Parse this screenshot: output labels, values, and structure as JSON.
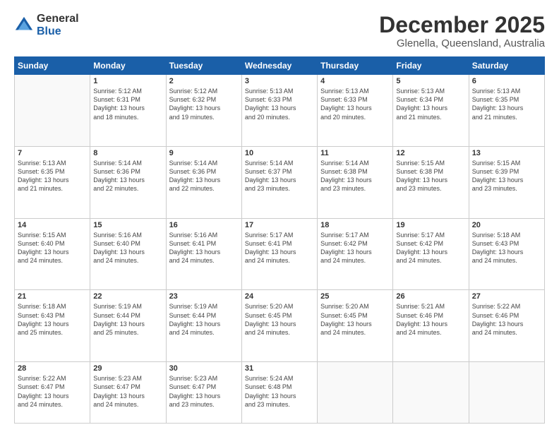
{
  "logo": {
    "general": "General",
    "blue": "Blue"
  },
  "header": {
    "title": "December 2025",
    "subtitle": "Glenella, Queensland, Australia"
  },
  "weekdays": [
    "Sunday",
    "Monday",
    "Tuesday",
    "Wednesday",
    "Thursday",
    "Friday",
    "Saturday"
  ],
  "weeks": [
    [
      {
        "day": "",
        "info": ""
      },
      {
        "day": "1",
        "info": "Sunrise: 5:12 AM\nSunset: 6:31 PM\nDaylight: 13 hours\nand 18 minutes."
      },
      {
        "day": "2",
        "info": "Sunrise: 5:12 AM\nSunset: 6:32 PM\nDaylight: 13 hours\nand 19 minutes."
      },
      {
        "day": "3",
        "info": "Sunrise: 5:13 AM\nSunset: 6:33 PM\nDaylight: 13 hours\nand 20 minutes."
      },
      {
        "day": "4",
        "info": "Sunrise: 5:13 AM\nSunset: 6:33 PM\nDaylight: 13 hours\nand 20 minutes."
      },
      {
        "day": "5",
        "info": "Sunrise: 5:13 AM\nSunset: 6:34 PM\nDaylight: 13 hours\nand 21 minutes."
      },
      {
        "day": "6",
        "info": "Sunrise: 5:13 AM\nSunset: 6:35 PM\nDaylight: 13 hours\nand 21 minutes."
      }
    ],
    [
      {
        "day": "7",
        "info": "Sunrise: 5:13 AM\nSunset: 6:35 PM\nDaylight: 13 hours\nand 21 minutes."
      },
      {
        "day": "8",
        "info": "Sunrise: 5:14 AM\nSunset: 6:36 PM\nDaylight: 13 hours\nand 22 minutes."
      },
      {
        "day": "9",
        "info": "Sunrise: 5:14 AM\nSunset: 6:36 PM\nDaylight: 13 hours\nand 22 minutes."
      },
      {
        "day": "10",
        "info": "Sunrise: 5:14 AM\nSunset: 6:37 PM\nDaylight: 13 hours\nand 23 minutes."
      },
      {
        "day": "11",
        "info": "Sunrise: 5:14 AM\nSunset: 6:38 PM\nDaylight: 13 hours\nand 23 minutes."
      },
      {
        "day": "12",
        "info": "Sunrise: 5:15 AM\nSunset: 6:38 PM\nDaylight: 13 hours\nand 23 minutes."
      },
      {
        "day": "13",
        "info": "Sunrise: 5:15 AM\nSunset: 6:39 PM\nDaylight: 13 hours\nand 23 minutes."
      }
    ],
    [
      {
        "day": "14",
        "info": "Sunrise: 5:15 AM\nSunset: 6:40 PM\nDaylight: 13 hours\nand 24 minutes."
      },
      {
        "day": "15",
        "info": "Sunrise: 5:16 AM\nSunset: 6:40 PM\nDaylight: 13 hours\nand 24 minutes."
      },
      {
        "day": "16",
        "info": "Sunrise: 5:16 AM\nSunset: 6:41 PM\nDaylight: 13 hours\nand 24 minutes."
      },
      {
        "day": "17",
        "info": "Sunrise: 5:17 AM\nSunset: 6:41 PM\nDaylight: 13 hours\nand 24 minutes."
      },
      {
        "day": "18",
        "info": "Sunrise: 5:17 AM\nSunset: 6:42 PM\nDaylight: 13 hours\nand 24 minutes."
      },
      {
        "day": "19",
        "info": "Sunrise: 5:17 AM\nSunset: 6:42 PM\nDaylight: 13 hours\nand 24 minutes."
      },
      {
        "day": "20",
        "info": "Sunrise: 5:18 AM\nSunset: 6:43 PM\nDaylight: 13 hours\nand 24 minutes."
      }
    ],
    [
      {
        "day": "21",
        "info": "Sunrise: 5:18 AM\nSunset: 6:43 PM\nDaylight: 13 hours\nand 25 minutes."
      },
      {
        "day": "22",
        "info": "Sunrise: 5:19 AM\nSunset: 6:44 PM\nDaylight: 13 hours\nand 25 minutes."
      },
      {
        "day": "23",
        "info": "Sunrise: 5:19 AM\nSunset: 6:44 PM\nDaylight: 13 hours\nand 24 minutes."
      },
      {
        "day": "24",
        "info": "Sunrise: 5:20 AM\nSunset: 6:45 PM\nDaylight: 13 hours\nand 24 minutes."
      },
      {
        "day": "25",
        "info": "Sunrise: 5:20 AM\nSunset: 6:45 PM\nDaylight: 13 hours\nand 24 minutes."
      },
      {
        "day": "26",
        "info": "Sunrise: 5:21 AM\nSunset: 6:46 PM\nDaylight: 13 hours\nand 24 minutes."
      },
      {
        "day": "27",
        "info": "Sunrise: 5:22 AM\nSunset: 6:46 PM\nDaylight: 13 hours\nand 24 minutes."
      }
    ],
    [
      {
        "day": "28",
        "info": "Sunrise: 5:22 AM\nSunset: 6:47 PM\nDaylight: 13 hours\nand 24 minutes."
      },
      {
        "day": "29",
        "info": "Sunrise: 5:23 AM\nSunset: 6:47 PM\nDaylight: 13 hours\nand 24 minutes."
      },
      {
        "day": "30",
        "info": "Sunrise: 5:23 AM\nSunset: 6:47 PM\nDaylight: 13 hours\nand 23 minutes."
      },
      {
        "day": "31",
        "info": "Sunrise: 5:24 AM\nSunset: 6:48 PM\nDaylight: 13 hours\nand 23 minutes."
      },
      {
        "day": "",
        "info": ""
      },
      {
        "day": "",
        "info": ""
      },
      {
        "day": "",
        "info": ""
      }
    ]
  ]
}
